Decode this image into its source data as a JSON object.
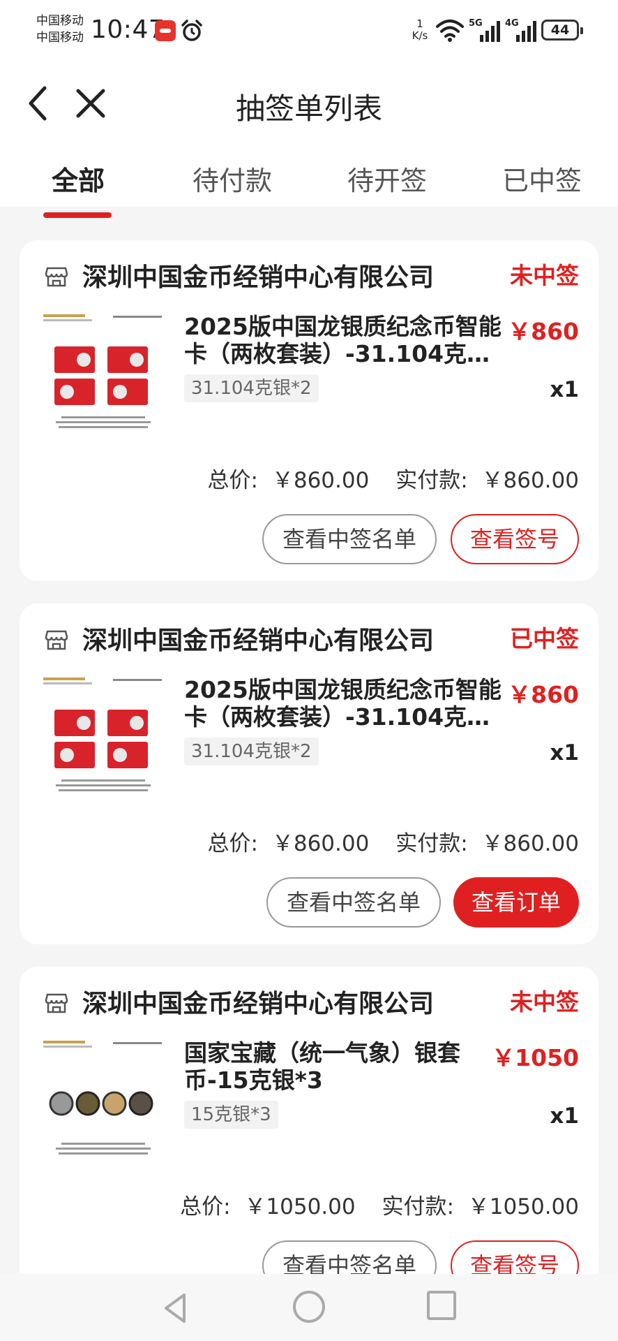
{
  "status_bar": {
    "carrier_1": "中国移动",
    "carrier_2": "中国移动",
    "time": "10:47",
    "net_speed_value": "1",
    "net_speed_unit": "K/s",
    "signal_1": "5G",
    "signal_2": "4G",
    "battery": "44"
  },
  "header": {
    "title": "抽签单列表",
    "tabs": [
      {
        "label": "全部",
        "active": true
      },
      {
        "label": "待付款",
        "active": false
      },
      {
        "label": "待开签",
        "active": false
      },
      {
        "label": "已中签",
        "active": false
      }
    ]
  },
  "colors": {
    "accent": "#e02020",
    "background": "#f5f5f5"
  },
  "orders": [
    {
      "store": "深圳中国金币经销中心有限公司",
      "status": "未中签",
      "title": "2025版中国龙银质纪念币智能卡（两枚套装）-31.104克…",
      "price": "￥860",
      "spec": "31.104克银*2",
      "qty": "x1",
      "total_label": "总价:",
      "total": "￥860.00",
      "paid_label": "实付款:",
      "paid": "￥860.00",
      "btn_1": "查看中签名单",
      "btn_2": "查看签号"
    },
    {
      "store": "深圳中国金币经销中心有限公司",
      "status": "已中签",
      "title": "2025版中国龙银质纪念币智能卡（两枚套装）-31.104克…",
      "price": "￥860",
      "spec": "31.104克银*2",
      "qty": "x1",
      "total_label": "总价:",
      "total": "￥860.00",
      "paid_label": "实付款:",
      "paid": "￥860.00",
      "btn_1": "查看中签名单",
      "btn_2": "查看订单"
    },
    {
      "store": "深圳中国金币经销中心有限公司",
      "status": "未中签",
      "title": "国家宝藏（统一气象）银套币-15克银*3",
      "price": "￥1050",
      "spec": "15克银*3",
      "qty": "x1",
      "total_label": "总价:",
      "total": "￥1050.00",
      "paid_label": "实付款:",
      "paid": "￥1050.00",
      "btn_1": "查看中签名单",
      "btn_2": "查看签号"
    }
  ],
  "icons": {
    "back": "chevron-left-icon",
    "close": "close-icon",
    "store": "store-icon",
    "nav_back": "triangle-back-icon",
    "nav_home": "circle-home-icon",
    "nav_recent": "square-recent-icon"
  }
}
